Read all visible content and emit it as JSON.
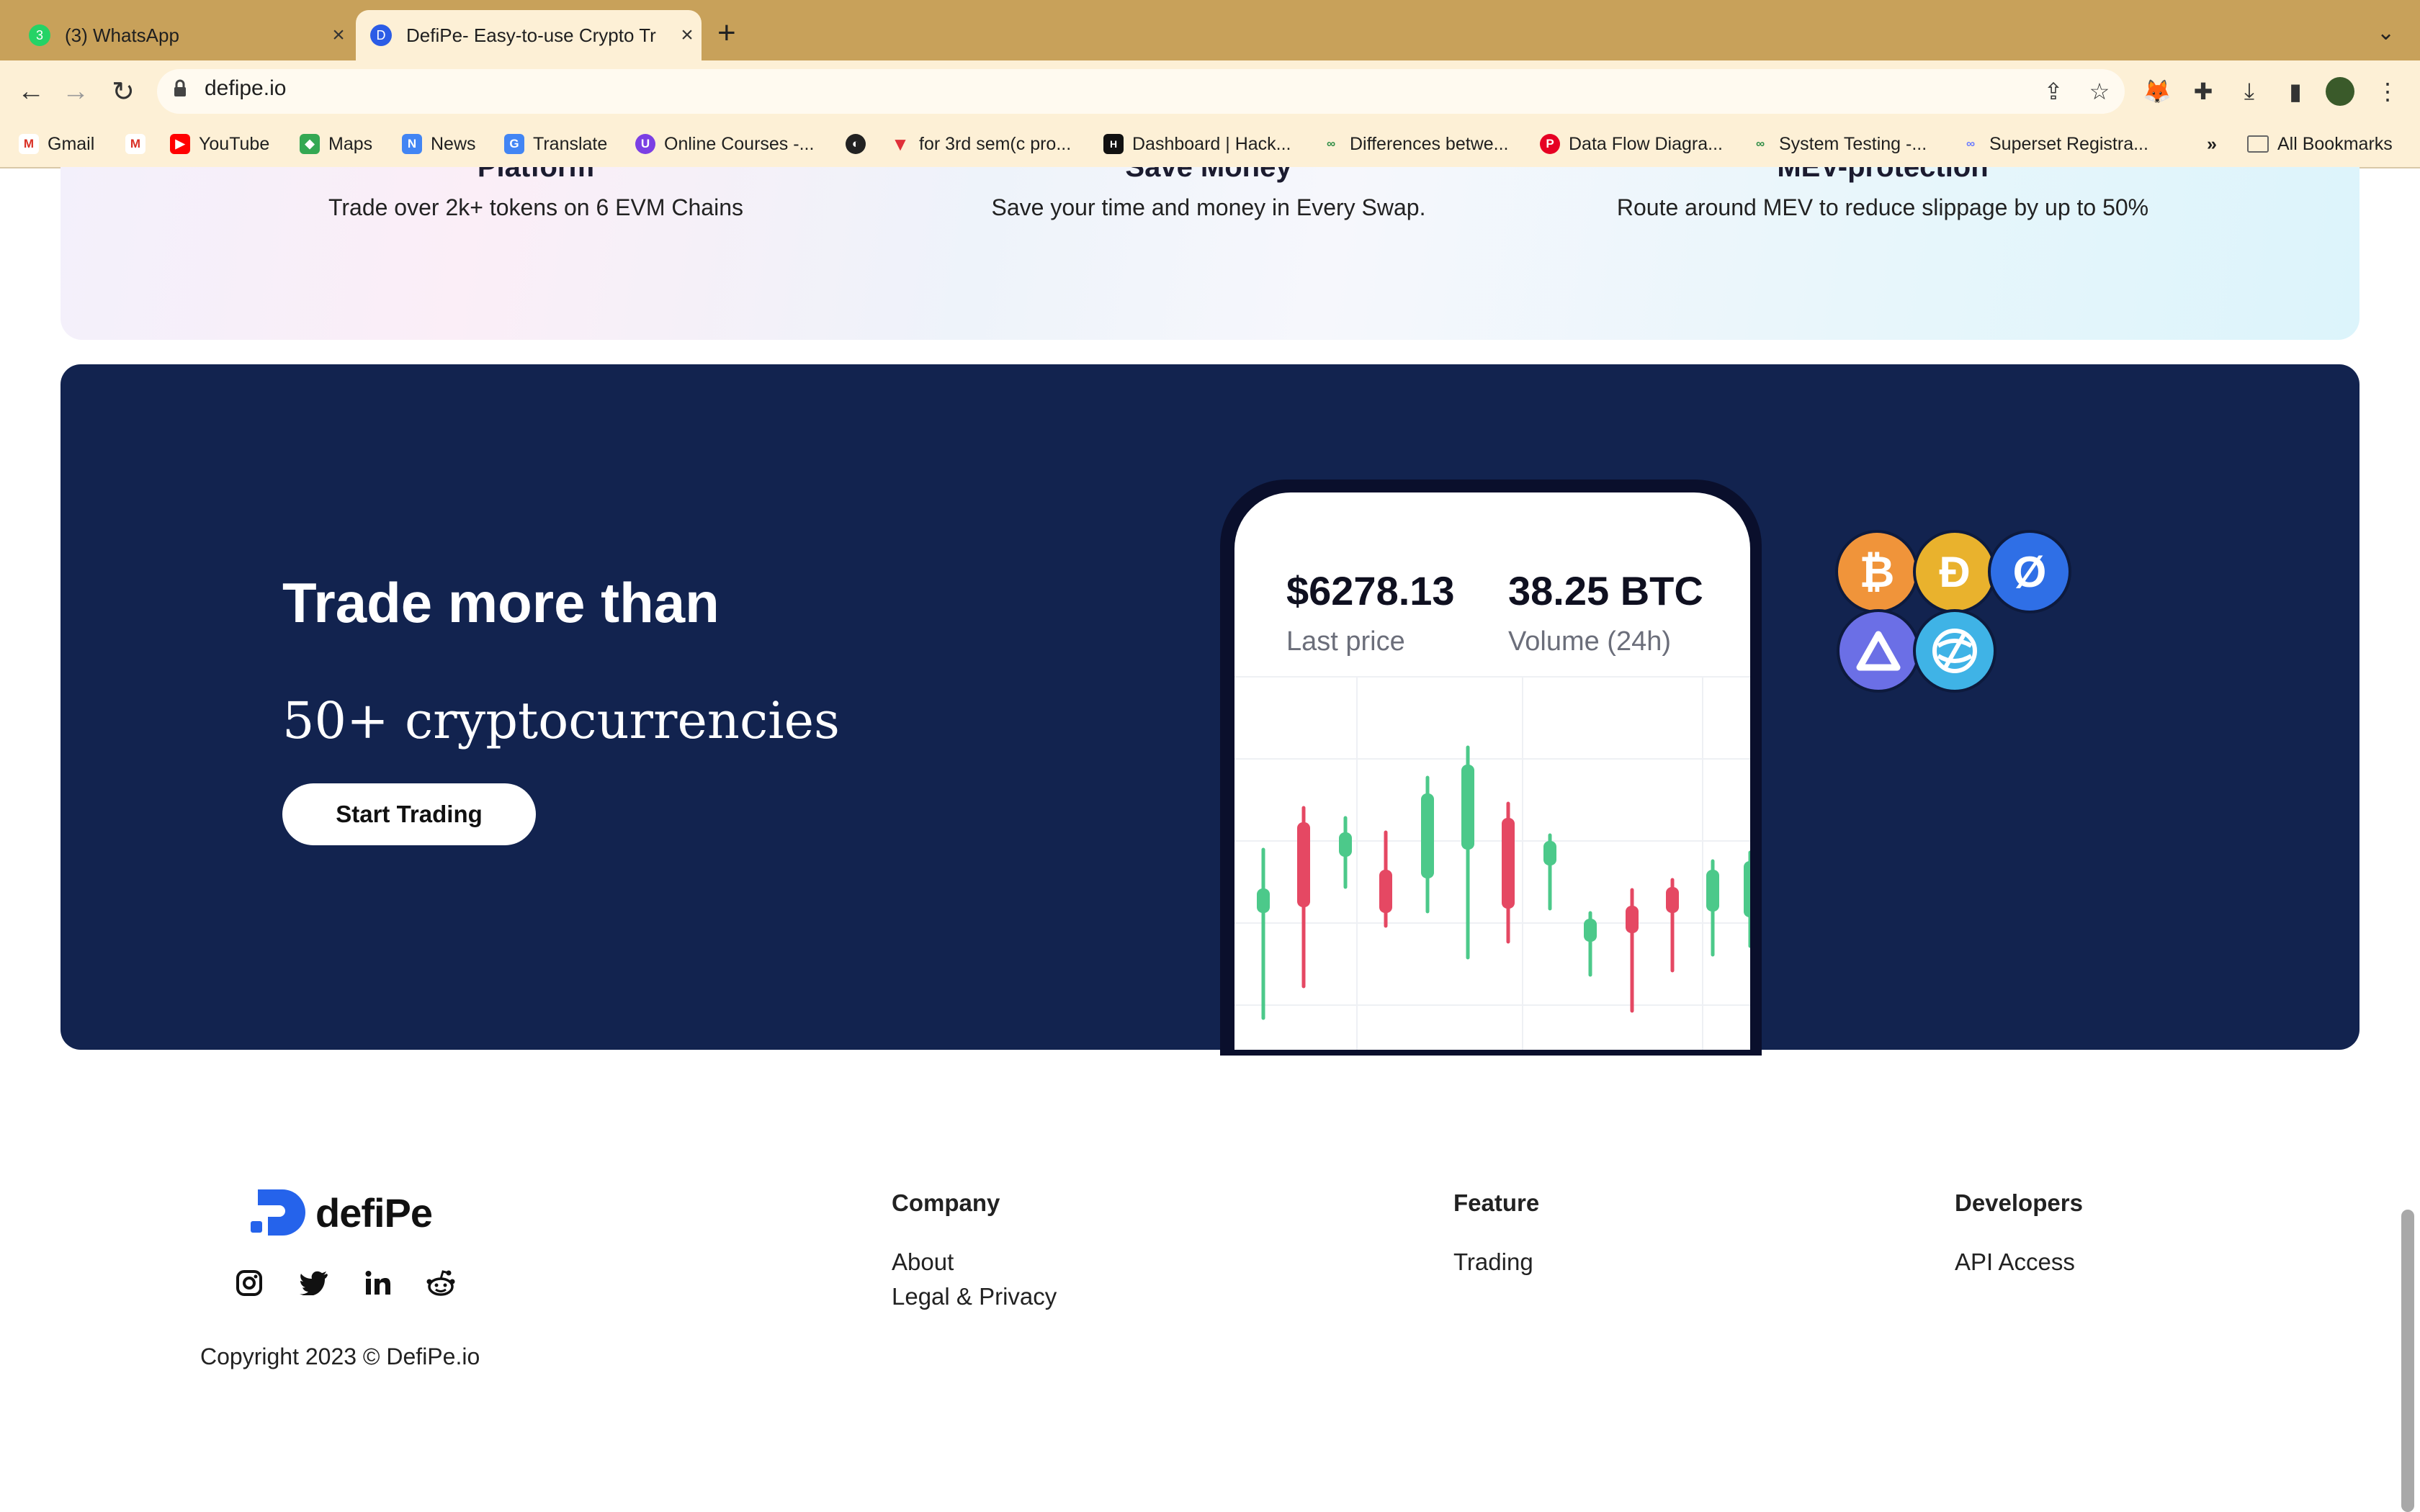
{
  "browser": {
    "tabs": [
      {
        "title": "(3) WhatsApp",
        "active": false
      },
      {
        "title": "DefiPe- Easy-to-use Crypto Tr",
        "active": true
      }
    ],
    "url": "defipe.io",
    "bookmarks": [
      {
        "label": "Gmail",
        "icon": "gmail-icon"
      },
      {
        "label": "",
        "icon": "gmail-icon"
      },
      {
        "label": "YouTube",
        "icon": "youtube-icon"
      },
      {
        "label": "Maps",
        "icon": "maps-icon"
      },
      {
        "label": "News",
        "icon": "news-icon"
      },
      {
        "label": "Translate",
        "icon": "translate-icon"
      },
      {
        "label": "Online Courses -...",
        "icon": "courses-icon"
      },
      {
        "label": "",
        "icon": "globe-icon"
      },
      {
        "label": "for 3rd sem(c pro...",
        "icon": "bookmark-icon"
      },
      {
        "label": "Dashboard | Hack...",
        "icon": "hackerrank-icon"
      },
      {
        "label": "Differences betwe...",
        "icon": "link-icon"
      },
      {
        "label": "Data Flow Diagra...",
        "icon": "pinterest-icon"
      },
      {
        "label": "System Testing -...",
        "icon": "link-icon"
      },
      {
        "label": "Superset Registra...",
        "icon": "superset-icon"
      }
    ],
    "overflow_label": "»",
    "all_bookmarks": "All Bookmarks"
  },
  "features": [
    {
      "title": "Platform",
      "desc": "Trade over 2k+ tokens on 6 EVM Chains"
    },
    {
      "title": "Save Money",
      "desc": "Save your time and money in Every Swap."
    },
    {
      "title": "MEV-protection",
      "desc": "Route around MEV to reduce slippage by up to 50%"
    }
  ],
  "promo": {
    "headline": "Trade more than",
    "subheadline": "50+ cryptocurrencies",
    "cta": "Start Trading",
    "last_price": "$6278.13",
    "last_price_label": "Last price",
    "volume": "38.25 BTC",
    "volume_label": "Volume (24h)",
    "coins": [
      "bitcoin-icon",
      "dogecoin-icon",
      "zero-coin-icon",
      "arc-coin-icon",
      "globe-coin-icon"
    ],
    "colors": {
      "bull": "#4cc98a",
      "bear": "#e54863",
      "panel": "#12234f"
    }
  },
  "footer": {
    "brand": "defiPe",
    "social": [
      "instagram-icon",
      "twitter-icon",
      "linkedin-icon",
      "reddit-icon"
    ],
    "copyright": "Copyright 2023 © DefiPe.io",
    "columns": [
      {
        "heading": "Company",
        "links": [
          "About",
          "Legal & Privacy"
        ]
      },
      {
        "heading": "Feature",
        "links": [
          "Trading"
        ]
      },
      {
        "heading": "Developers",
        "links": [
          "API Access"
        ]
      }
    ]
  }
}
